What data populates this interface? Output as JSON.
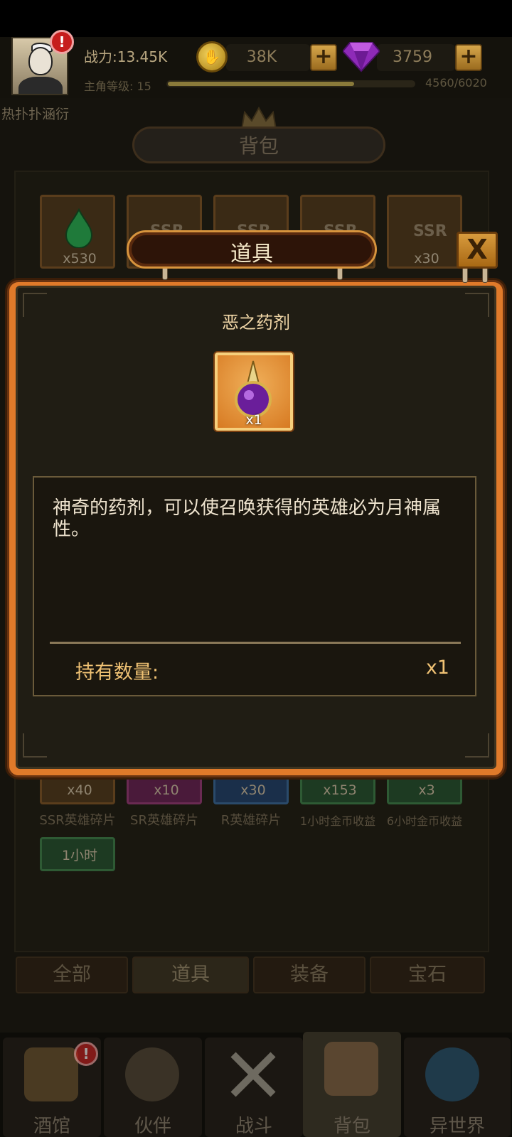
{
  "header": {
    "power": "战力:13.45K",
    "coins": "38K",
    "gems": "3759",
    "level_label": "主角等级: 15",
    "xp_text": "4560/6020",
    "xp_fraction": 0.757,
    "player_name": "热扑扑涵衍",
    "alert_mark": "!"
  },
  "bag": {
    "title": "背包",
    "top_slots": [
      {
        "count": "x530",
        "card": ""
      },
      {
        "count": "",
        "card": "SSR"
      },
      {
        "count": "",
        "card": "SSR"
      },
      {
        "count": "",
        "card": "SSR"
      },
      {
        "count": "x30",
        "card": "SSR"
      }
    ],
    "row_counts": [
      "x40",
      "x10",
      "x30",
      "x153",
      "x3"
    ],
    "row_labels": [
      "SSR英雄碎片",
      "SR英雄碎片",
      "R英雄碎片",
      "1小时金币收益",
      "6小时金币收益"
    ],
    "extra_slot_label": "1小时",
    "tabs": [
      "全部",
      "道具",
      "装备",
      "宝石"
    ]
  },
  "nav": {
    "items": [
      "酒馆",
      "伙伴",
      "战斗",
      "背包",
      "异世界"
    ],
    "alert_mark": "!"
  },
  "modal": {
    "title": "道具",
    "close_label": "X",
    "item_name": "恶之药剂",
    "item_count": "x1",
    "description": "神奇的药剂，可以使召唤获得的英雄必为月神属性。",
    "own_label": "持有数量:",
    "own_value": "x1"
  },
  "colors": {
    "modal_frame": "#e07a2a",
    "accent_text": "#f0c274",
    "panel_bg": "#201d14"
  }
}
